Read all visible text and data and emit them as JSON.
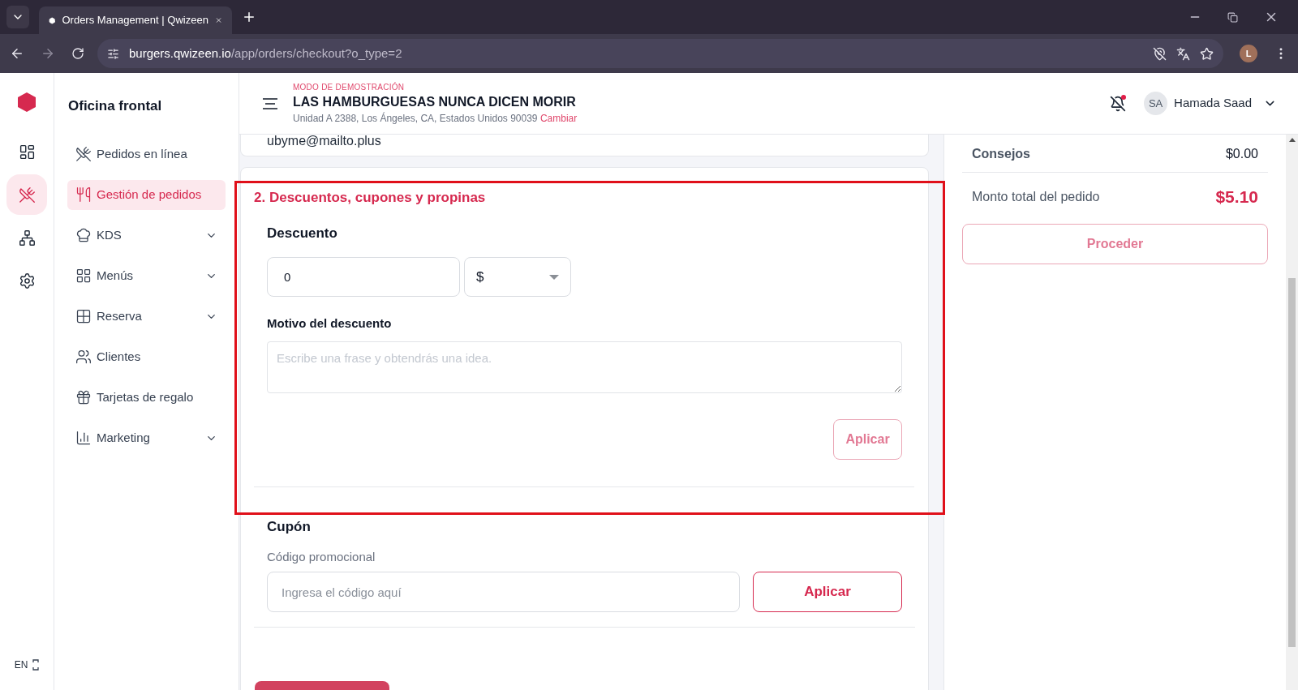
{
  "browser": {
    "tab_title": "Orders Management | Qwizeen",
    "url_host": "burgers.qwizeen.io",
    "url_path": "/app/orders/checkout?o_type=2",
    "profile_initial": "L"
  },
  "rail": {
    "items": [
      {
        "selected": false
      },
      {
        "selected": true
      },
      {
        "selected": false
      },
      {
        "selected": false
      }
    ],
    "language": "EN"
  },
  "sidebar": {
    "title": "Oficina frontal",
    "items": [
      {
        "label": "Pedidos en línea",
        "selected": false,
        "has_submenu": false
      },
      {
        "label": "Gestión de pedidos",
        "selected": true,
        "has_submenu": false
      },
      {
        "label": "KDS",
        "selected": false,
        "has_submenu": true
      },
      {
        "label": "Menús",
        "selected": false,
        "has_submenu": true
      },
      {
        "label": "Reserva",
        "selected": false,
        "has_submenu": true
      },
      {
        "label": "Clientes",
        "selected": false,
        "has_submenu": false
      },
      {
        "label": "Tarjetas de regalo",
        "selected": false,
        "has_submenu": false
      },
      {
        "label": "Marketing",
        "selected": false,
        "has_submenu": true
      }
    ]
  },
  "header": {
    "demo_label": "MODO DE DEMOSTRACIÓN",
    "restaurant": "LAS HAMBURGUESAS NUNCA DICEN MORIR",
    "address": "Unidad A 2388, Los Ángeles, CA, Estados Unidos 90039",
    "change_link": "Cambiar",
    "notification_dot": true,
    "user_initials": "SA",
    "user_name": "Hamada Saad"
  },
  "contact": {
    "email": "ubyme@mailto.plus"
  },
  "discounts": {
    "title": "2. Descuentos, cupones y propinas",
    "highlighted": true,
    "discount": {
      "heading": "Descuento",
      "value": "0",
      "unit": "$",
      "reason_label": "Motivo del descuento",
      "reason_placeholder": "Escribe una frase y obtendrás una idea.",
      "apply": {
        "label": "Aplicar",
        "disabled": true
      }
    },
    "coupon": {
      "heading": "Cupón",
      "code_label": "Código promocional",
      "code_placeholder": "Ingresa el código aquí",
      "apply": {
        "label": "Aplicar",
        "disabled": false
      }
    }
  },
  "summary": {
    "rows": [
      {
        "label": "Consejos",
        "value": "$0.00"
      }
    ],
    "total_label": "Monto total del pedido",
    "total_value": "$5.10",
    "proceed": {
      "label": "Proceder",
      "disabled": true
    }
  }
}
